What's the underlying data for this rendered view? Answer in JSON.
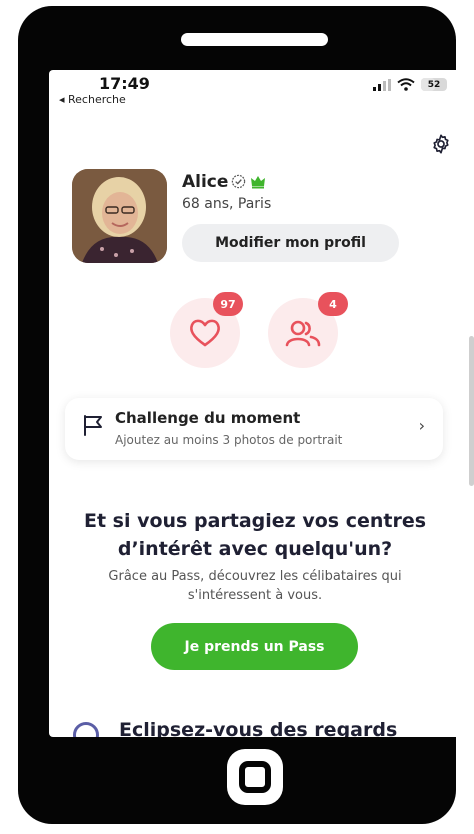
{
  "status_bar": {
    "time": "17:49",
    "back_label": "◂ Recherche",
    "battery_level": "52"
  },
  "profile": {
    "name": "Alice",
    "age_city": "68 ans, Paris",
    "edit_button": "Modifier mon profil"
  },
  "stats": {
    "likes_count": "97",
    "matches_count": "4"
  },
  "challenge": {
    "title": "Challenge du moment",
    "subtitle": "Ajoutez au moins 3 photos de portrait",
    "arrow": "›"
  },
  "promo": {
    "headline_line1": "Et si vous partagiez vos centres",
    "headline_line2": "d’intérêt avec quelqu'un?",
    "subtext_line1": "Grâce au Pass, découvrez les célibataires qui",
    "subtext_line2": "s'intéressent à vous.",
    "cta": "Je prends un Pass"
  },
  "next_section": {
    "title": "Eclipsez-vous des regards"
  },
  "colors": {
    "accent_green": "#3fb52d",
    "badge_red": "#e8525c",
    "pink_bg": "#fcebec",
    "crown_green": "#3fb52d"
  },
  "icons": [
    "gear-icon",
    "verified-icon",
    "crown-icon",
    "heart-icon",
    "people-icon",
    "flag-icon",
    "chevron-right-icon",
    "wifi-icon",
    "signal-icon",
    "battery-icon"
  ]
}
